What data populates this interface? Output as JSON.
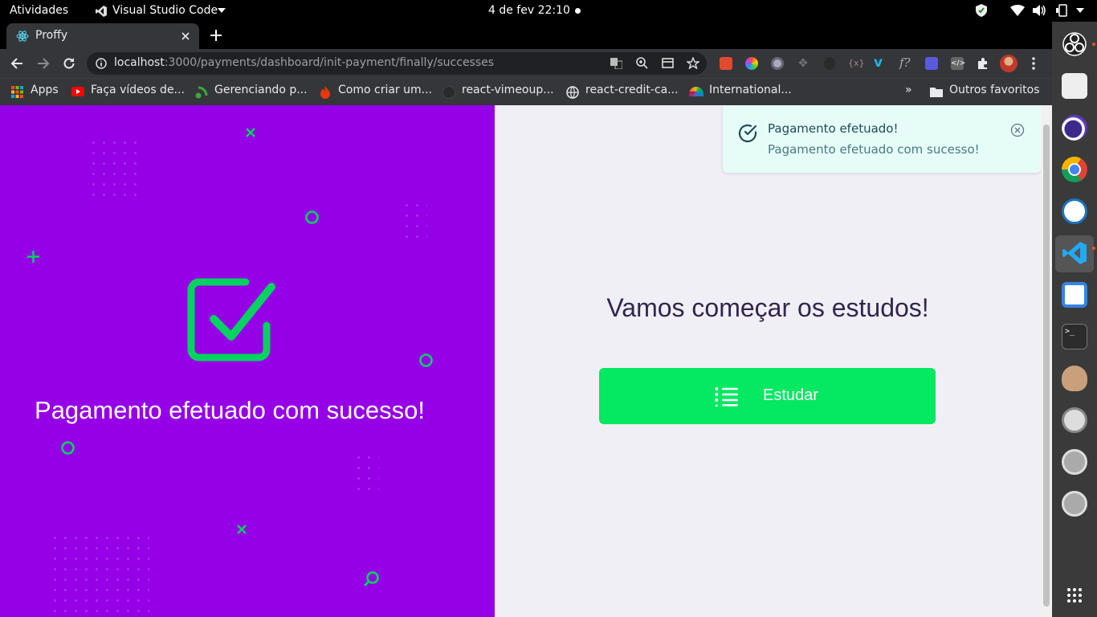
{
  "system_bar": {
    "activities": "Atividades",
    "app_name": "Visual Studio Code",
    "datetime": "4 de fev  22:10"
  },
  "browser": {
    "tab": {
      "title": "Proffy"
    },
    "address": {
      "host": "localhost",
      "path": ":3000/payments/dashboard/init-payment/finally/successes"
    },
    "bookmarks": [
      {
        "label": "Apps",
        "icon": "apps-grid-icon"
      },
      {
        "label": "Faça vídeos de...",
        "icon": "youtube-icon"
      },
      {
        "label": "Gerenciando p...",
        "icon": "site-icon"
      },
      {
        "label": "Como criar um...",
        "icon": "fire-icon"
      },
      {
        "label": "react-vimeoup...",
        "icon": "github-icon"
      },
      {
        "label": "react-credit-ca...",
        "icon": "globe-icon"
      },
      {
        "label": "International...",
        "icon": "nbc-icon"
      }
    ],
    "more": "»",
    "other_favorites": "Outros favoritos"
  },
  "page": {
    "success_title": "Pagamento efetuado com sucesso!",
    "heading": "Vamos começar os estudos!",
    "study_button": "Estudar",
    "toast": {
      "title": "Pagamento efetuado!",
      "message": "Pagamento efetuado com sucesso!"
    }
  },
  "colors": {
    "purple": "#9500e6",
    "green": "#04d361",
    "button_green": "#04e862",
    "toast_bg": "#e6fdf7",
    "heading": "#32264d"
  }
}
